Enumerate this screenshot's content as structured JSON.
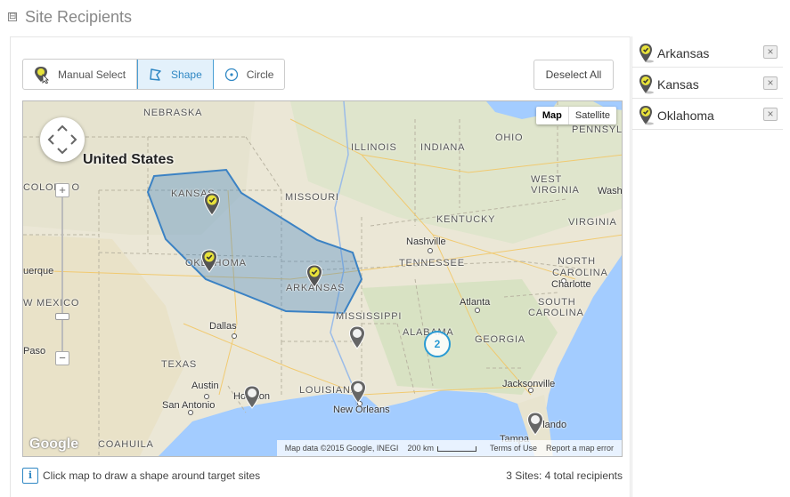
{
  "section": {
    "title": "Site Recipients",
    "collapse_glyph": "⊟"
  },
  "toolbar": {
    "manual_select": "Manual Select",
    "shape": "Shape",
    "circle": "Circle",
    "deselect_all": "Deselect All",
    "active_tool": "Shape",
    "accent_color": "#3088c4"
  },
  "map": {
    "type_buttons": {
      "map": "Map",
      "satellite": "Satellite"
    },
    "country_label": "United States",
    "state_labels": {
      "nebraska": "NEBRASKA",
      "kansas": "KANSAS",
      "oklahoma": "OKLAHOMA",
      "arkansas": "ARKANSAS",
      "missouri": "MISSOURI",
      "illinois": "ILLINOIS",
      "indiana": "INDIANA",
      "ohio": "OHIO",
      "pennsylvania": "PENNSYL",
      "west_virginia_1": "WEST",
      "west_virginia_2": "VIRGINIA",
      "virginia": "VIRGINIA",
      "kentucky": "KENTUCKY",
      "tennessee": "TENNESSEE",
      "north_carolina_1": "NORTH",
      "north_carolina_2": "CAROLINA",
      "south_carolina_1": "SOUTH",
      "south_carolina_2": "CAROLINA",
      "mississippi": "MISSISSIPPI",
      "alabama": "ALABAMA",
      "georgia": "GEORGIA",
      "texas": "TEXAS",
      "louisiana": "LOUISIANA",
      "new_mexico": "W MEXICO",
      "colorado": "COLORA O",
      "coahuila": "COAHUILA"
    },
    "city_labels": {
      "nashville": "Nashville",
      "charlotte": "Charlotte",
      "atlanta": "Atlanta",
      "dallas": "Dallas",
      "austin": "Austin",
      "san_antonio": "San Antonio",
      "houston": "Houston",
      "new_orleans": "New Orleans",
      "jacksonville": "Jacksonville",
      "orlando": "Orlando",
      "tampa": "Tampa",
      "albuquerque": "uerque",
      "el_paso": "Paso",
      "washington": "Wash"
    },
    "cluster_count": "2",
    "google_logo": "Google",
    "attribution": {
      "data": "Map data ©2015 Google, INEGI",
      "scale": "200 km",
      "terms": "Terms of Use",
      "report": "Report a map error"
    },
    "zoom_in": "+",
    "zoom_out": "−",
    "water_color": "#a3ccff",
    "polygon_color": "#3b82c4"
  },
  "footer": {
    "info_glyph": "i",
    "hint": "Click map to draw a shape around target sites",
    "summary": "3 Sites: 4 total recipients"
  },
  "recipients": [
    {
      "name": "Arkansas"
    },
    {
      "name": "Kansas"
    },
    {
      "name": "Oklahoma"
    }
  ],
  "remove_glyph": "×"
}
